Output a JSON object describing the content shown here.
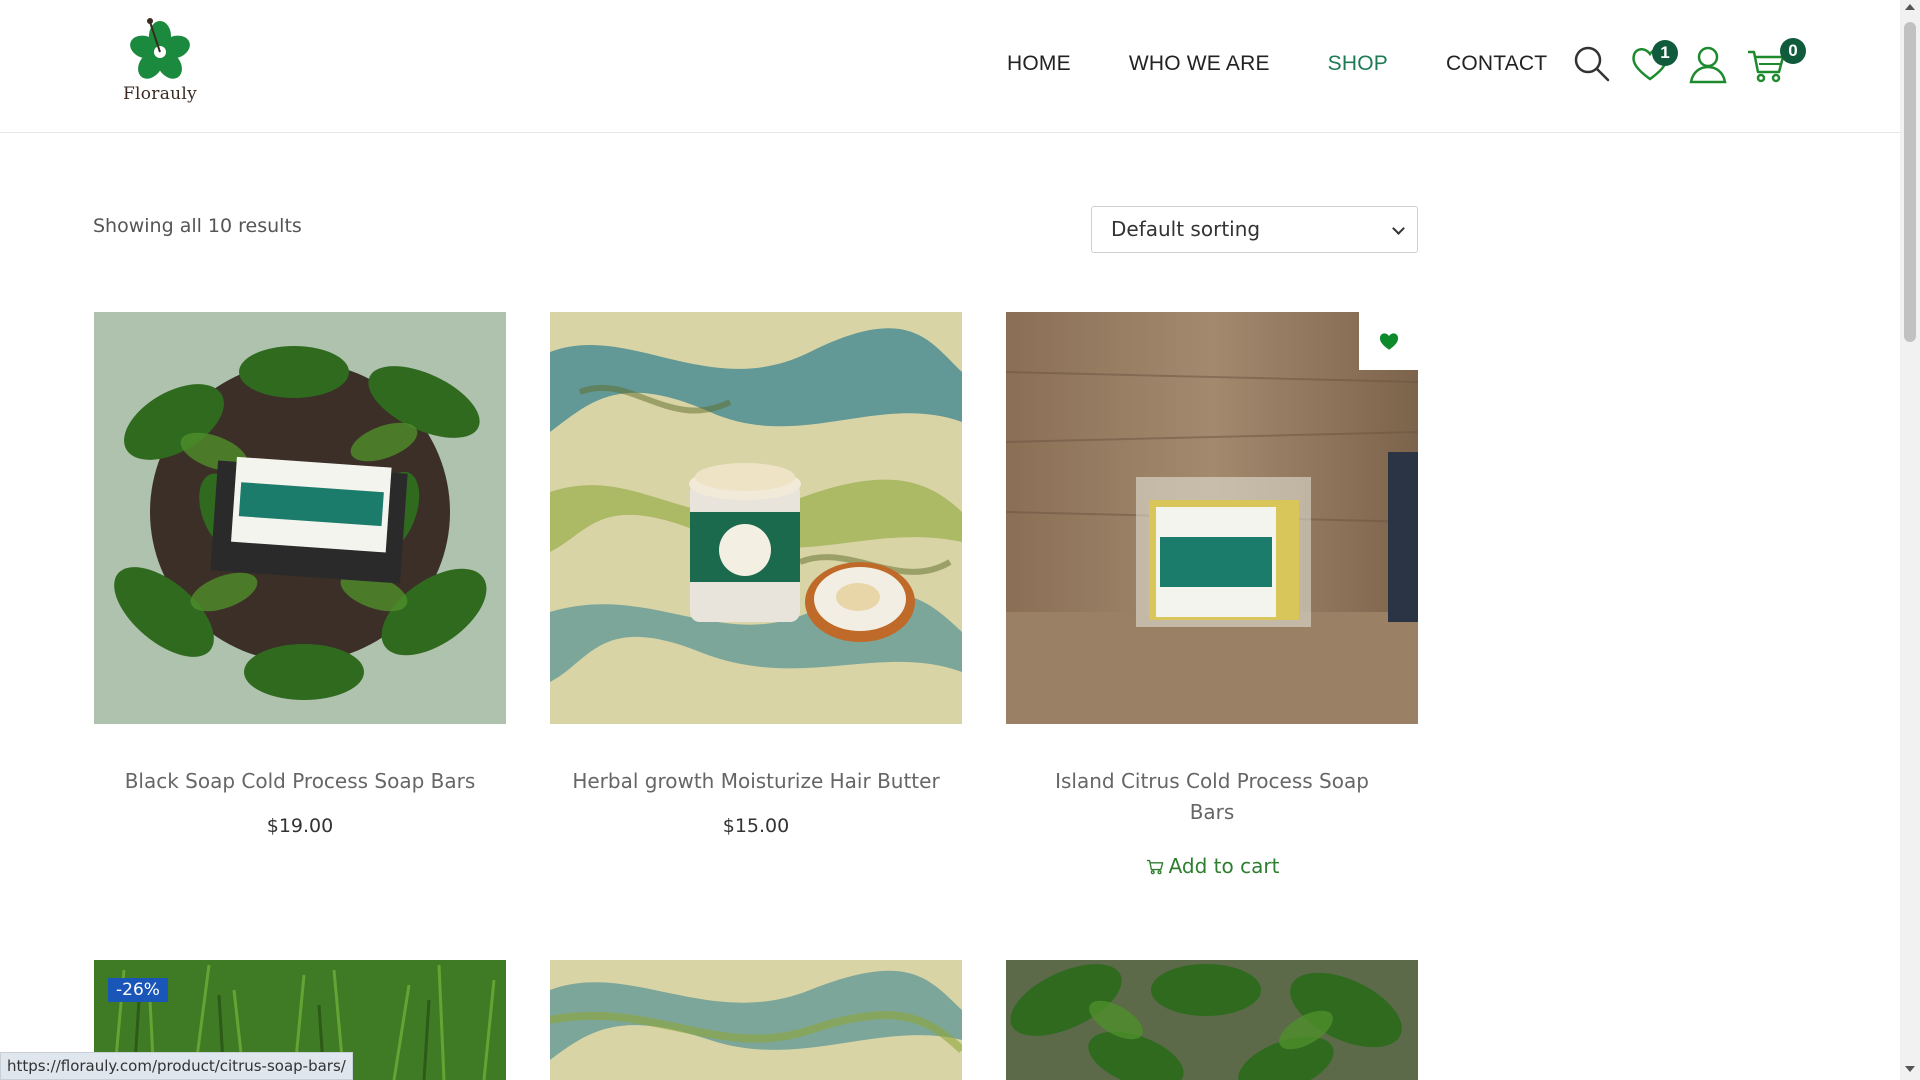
{
  "brand": {
    "name": "Florauly",
    "accent": "#0f5b3c",
    "logo_green": "#1c8a3e"
  },
  "nav": {
    "items": [
      {
        "label": "HOME",
        "active": false
      },
      {
        "label": "WHO WE ARE",
        "active": false
      },
      {
        "label": "SHOP",
        "active": true
      },
      {
        "label": "CONTACT",
        "active": false
      }
    ]
  },
  "header_icons": {
    "search": "search-icon",
    "wishlist": "heart-icon",
    "wishlist_count": "1",
    "account": "user-icon",
    "cart": "cart-icon",
    "cart_count": "0"
  },
  "toolbar": {
    "results_text": "Showing all 10 results",
    "sort_selected": "Default sorting"
  },
  "products": [
    {
      "title": "Black Soap Cold Process Soap Bars",
      "price": "$19.00",
      "image": "soap-on-plant-photo"
    },
    {
      "title": "Herbal growth Moisturize Hair Butter",
      "price": "$15.00",
      "image": "hair-butter-jar-photo"
    },
    {
      "title": "Island Citrus Cold Process Soap Bars",
      "action": "Add to cart",
      "image": "citrus-soap-bar-photo",
      "wishlisted": true
    }
  ],
  "next_row": [
    {
      "image": "grass-photo",
      "badge": "-26%"
    },
    {
      "image": "marble-photo"
    },
    {
      "image": "plant-photo"
    }
  ],
  "status_bar": {
    "url": "https://florauly.com/product/citrus-soap-bars/"
  }
}
